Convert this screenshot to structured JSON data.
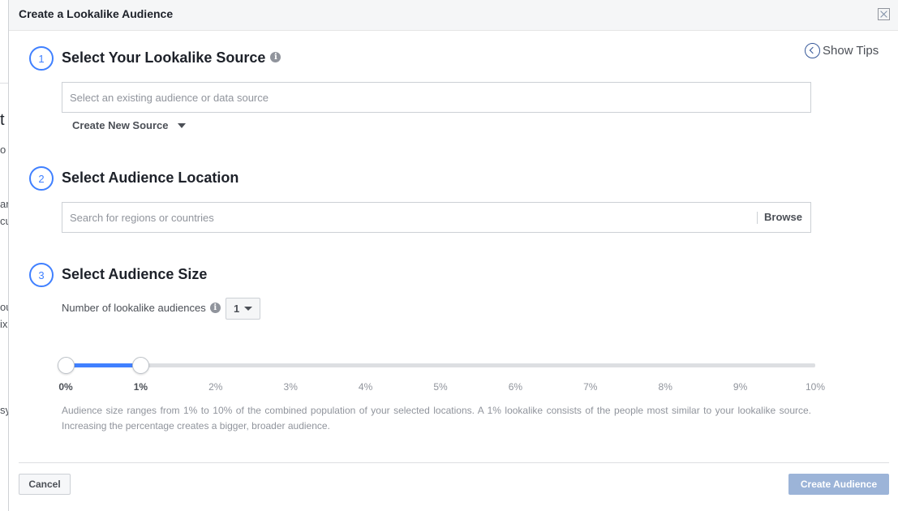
{
  "dialog": {
    "title": "Create a Lookalike Audience",
    "show_tips": "Show Tips"
  },
  "step1": {
    "number": "1",
    "title": "Select Your Lookalike Source",
    "placeholder": "Select an existing audience or data source",
    "create_new_source": "Create New Source"
  },
  "step2": {
    "number": "2",
    "title": "Select Audience Location",
    "placeholder": "Search for regions or countries",
    "browse": "Browse"
  },
  "step3": {
    "number": "3",
    "title": "Select Audience Size",
    "num_label": "Number of lookalike audiences",
    "num_value": "1",
    "slider_ticks": [
      "0%",
      "1%",
      "2%",
      "3%",
      "4%",
      "5%",
      "6%",
      "7%",
      "8%",
      "9%",
      "10%"
    ],
    "slider_range": [
      0,
      1
    ],
    "slider_max": 10,
    "help_text": "Audience size ranges from 1% to 10% of the combined population of your selected locations. A 1% lookalike consists of the people most similar to your lookalike source. Increasing the percentage creates a bigger, broader audience."
  },
  "footer": {
    "cancel": "Cancel",
    "create": "Create Audience"
  },
  "background_fragments": [
    "t",
    "o",
    "ar",
    "cu",
    "ou",
    "ix",
    "sy"
  ],
  "icons": {
    "info": "i",
    "show_tips": "chevron-left-circle-icon",
    "close": "close-icon",
    "caret": "caret-down-icon"
  },
  "colors": {
    "accent": "#4080ff",
    "create_button": "#9cb4d8",
    "muted_text": "#90949c"
  }
}
